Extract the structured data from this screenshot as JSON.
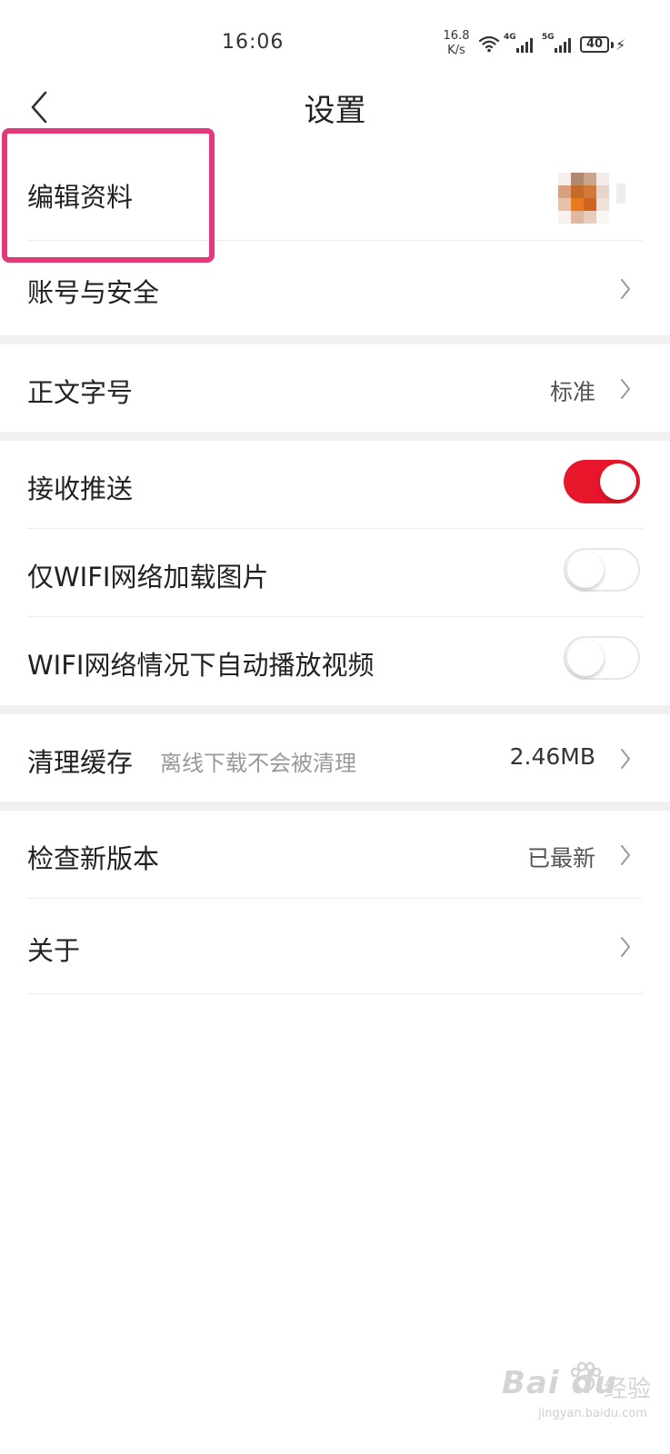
{
  "status_bar": {
    "time": "16:06",
    "net_speed_value": "16.8",
    "net_speed_unit": "K/s",
    "signal1_label": "4G",
    "signal2_label": "5G",
    "battery": "40",
    "icons": [
      "wifi-icon",
      "signal-icon",
      "signal-icon",
      "battery-icon",
      "charging-icon"
    ]
  },
  "header": {
    "title": "设置",
    "back_icon": "chevron-left-icon"
  },
  "settings": {
    "edit_profile": {
      "label": "编辑资料"
    },
    "account_security": {
      "label": "账号与安全"
    },
    "font_size": {
      "label": "正文字号",
      "value": "标准"
    },
    "receive_push": {
      "label": "接收推送",
      "enabled": true
    },
    "wifi_images_only": {
      "label": "仅WIFI网络加载图片",
      "enabled": false
    },
    "wifi_autoplay_video": {
      "label": "WIFI网络情况下自动播放视频",
      "enabled": false
    },
    "clear_cache": {
      "label": "清理缓存",
      "sub": "离线下载不会被清理",
      "value": "2.46MB"
    },
    "check_update": {
      "label": "检查新版本",
      "value": "已最新"
    },
    "about": {
      "label": "关于"
    }
  },
  "colors": {
    "toggle_on": "#e8162a",
    "highlight_box": "#e23a79",
    "section_gap": "#f0f0f0"
  },
  "watermark": {
    "brand": "Bai du",
    "text": "经验",
    "url": "jingyan.baidu.com"
  }
}
